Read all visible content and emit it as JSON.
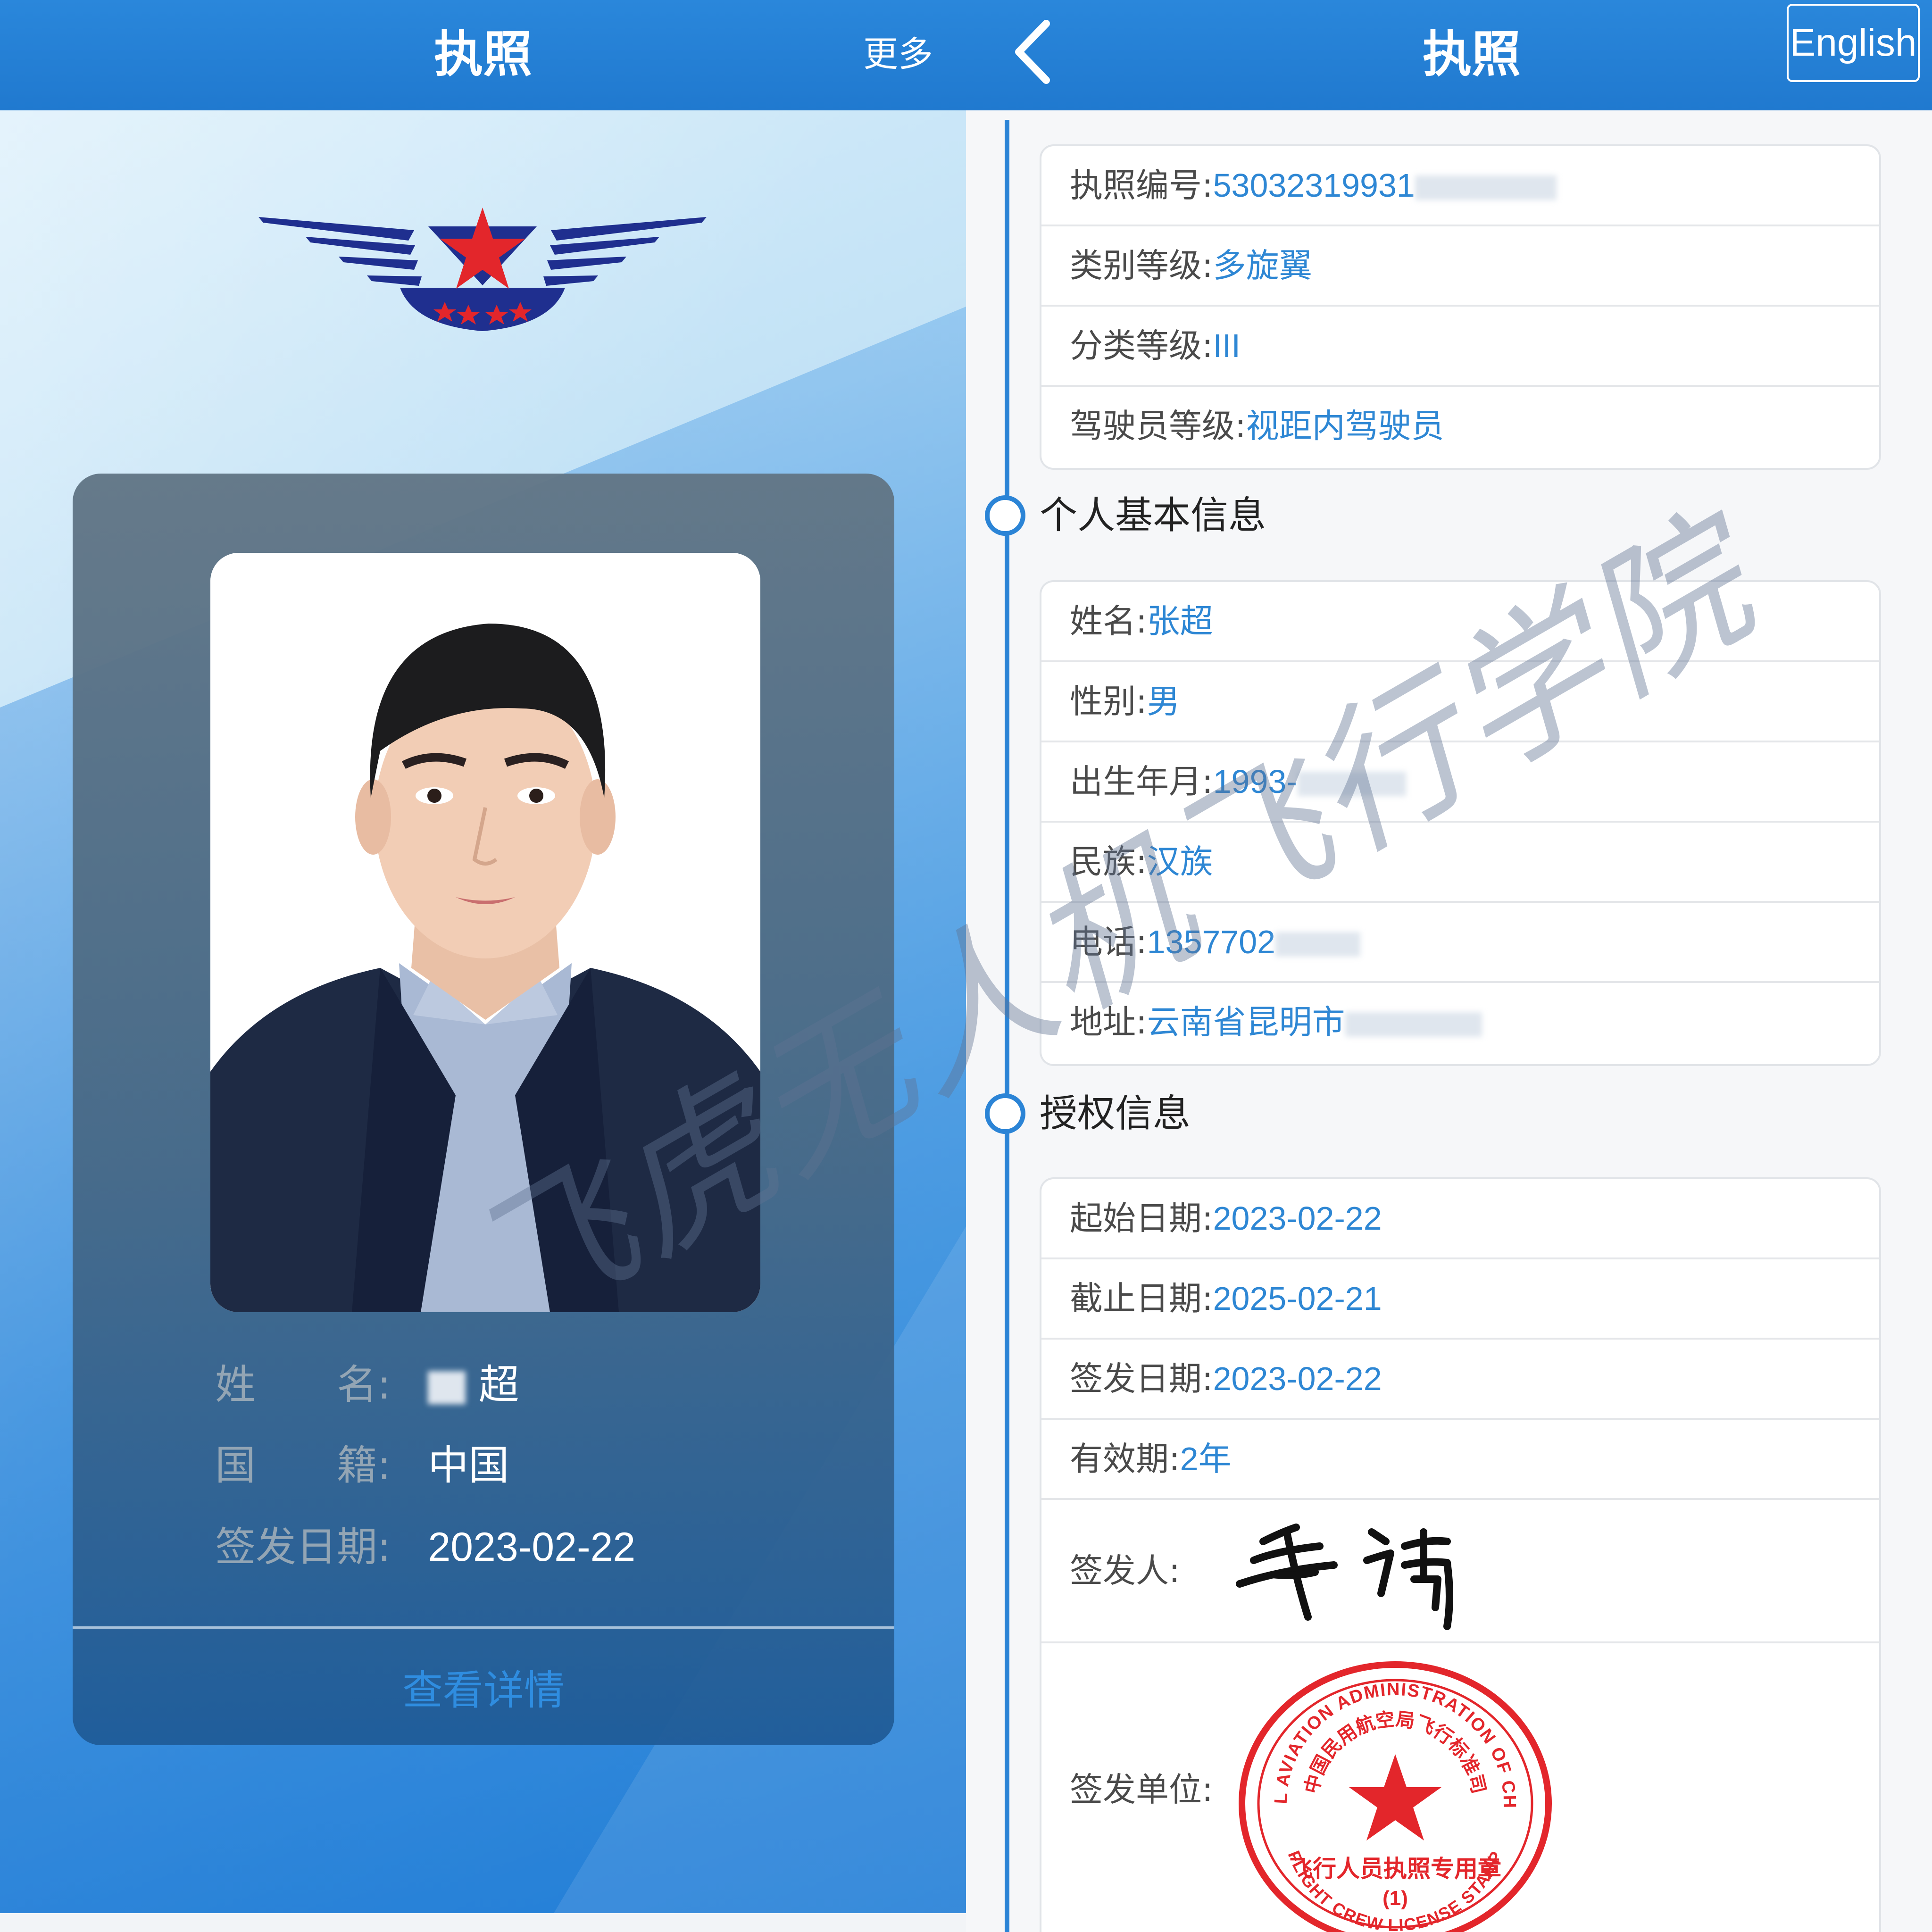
{
  "left_screen": {
    "header": {
      "title": "执照",
      "more_label": "更多"
    },
    "card": {
      "name_label": "姓　　名:",
      "name_value": "超",
      "nationality_label": "国　　籍:",
      "nationality_value": "中国",
      "issue_date_label": "签发日期:",
      "issue_date_value": "2023-02-22",
      "view_details_label": "查看详情"
    }
  },
  "right_screen": {
    "header": {
      "title": "执照",
      "language_button": "English"
    },
    "license_box": {
      "license_number_label": "执照编号:",
      "license_number_value": "53032319931",
      "category_label": "类别等级:",
      "category_value": "多旋翼",
      "class_label": "分类等级:",
      "class_value": "III",
      "pilot_level_label": "驾驶员等级:",
      "pilot_level_value": "视距内驾驶员"
    },
    "personal_section": {
      "title": "个人基本信息",
      "name_label": "姓名:",
      "name_value": "张超",
      "gender_label": "性别:",
      "gender_value": "男",
      "birth_label": "出生年月:",
      "birth_value": "1993-",
      "ethnicity_label": "民族:",
      "ethnicity_value": "汉族",
      "phone_label": "电话:",
      "phone_value": "1357702",
      "address_label": "地址:",
      "address_value": "云南省昆明市"
    },
    "authorization_section": {
      "title": "授权信息",
      "start_date_label": "起始日期:",
      "start_date_value": "2023-02-22",
      "end_date_label": "截止日期:",
      "end_date_value": "2025-02-21",
      "issue_date_label": "签发日期:",
      "issue_date_value": "2023-02-22",
      "validity_label": "有效期:",
      "validity_value": "2年",
      "issuer_label": "签发人:",
      "issuing_unit_label": "签发单位:"
    },
    "stamp": {
      "outer_text": "CIVIL AVIATION ADMINISTRATION OF CHINA",
      "inner_text": "中国民用航空局飞行标准司",
      "center_text": "飞行人员执照专用章",
      "number": "(1)",
      "bottom_text": "FLIGHT CREW LICENSE STAMP"
    }
  },
  "watermark": {
    "text": "飞虎无人机飞行学院"
  },
  "colors": {
    "header_blue": "#2a87db",
    "value_blue": "#2e87d4",
    "timeline_blue": "#2b84d6",
    "stamp_red": "#e3262b",
    "logo_navy": "#1f2f8f",
    "logo_red": "#e3262b"
  },
  "icons": {
    "back": "chevron-left-icon",
    "logo": "caac-wings-star-logo",
    "timeline": "circle-node-icon"
  }
}
